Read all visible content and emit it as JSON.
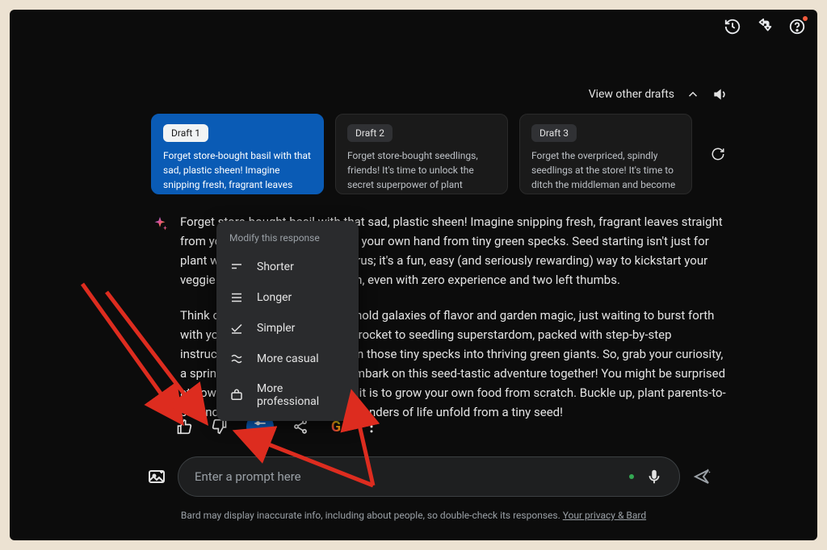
{
  "header": {
    "view_drafts": "View other drafts"
  },
  "drafts": [
    {
      "label": "Draft 1",
      "preview": "Forget store-bought basil with that sad, plastic sheen! Imagine snipping fresh, fragrant leaves straight from your windowsill,",
      "selected": true
    },
    {
      "label": "Draft 2",
      "preview": "Forget store-bought seedlings, friends! It's time to unlock the secret superpower of plant parenthood: growing your own",
      "selected": false
    },
    {
      "label": "Draft 3",
      "preview": "Forget the overpriced, spindly seedlings at the store! It's time to ditch the middleman and become your own plant-growing rockstar.",
      "selected": false
    }
  ],
  "response": {
    "p1": "Forget store-bought basil with that sad, plastic sheen! Imagine snipping fresh, fragrant leaves straight from your windowsill, nurtured by your own hand from tiny green specks. Seed starting isn't just for plant whisperers or gardening gurus; it's a fun, easy (and seriously rewarding) way to kickstart your veggie patch or indoor herb haven, even with zero experience and two left thumbs.",
    "p2": "Think of it this way: those seeds hold galaxies of flavor and garden magic, just waiting to burst forth with your help. This guide is your rocket to seedling superstardom, packed with step-by-step instructions and handy tips to turn those tiny specks into thriving green giants. So, grab your curiosity, a sprinkle of patience, and let's embark on this seed-tastic adventure together! You might be surprised at how much fun (and delicious!) it is to grow your own food from scratch. Buckle up, plant parents-to-be, and get ready to witness the wonders of life unfold from a tiny seed!"
  },
  "modify": {
    "title": "Modify this response",
    "items": [
      "Shorter",
      "Longer",
      "Simpler",
      "More casual",
      "More professional"
    ]
  },
  "prompt": {
    "placeholder": "Enter a prompt here"
  },
  "footer": {
    "text": "Bard may display inaccurate info, including about people, so double-check its responses. ",
    "link": "Your privacy & Bard"
  }
}
